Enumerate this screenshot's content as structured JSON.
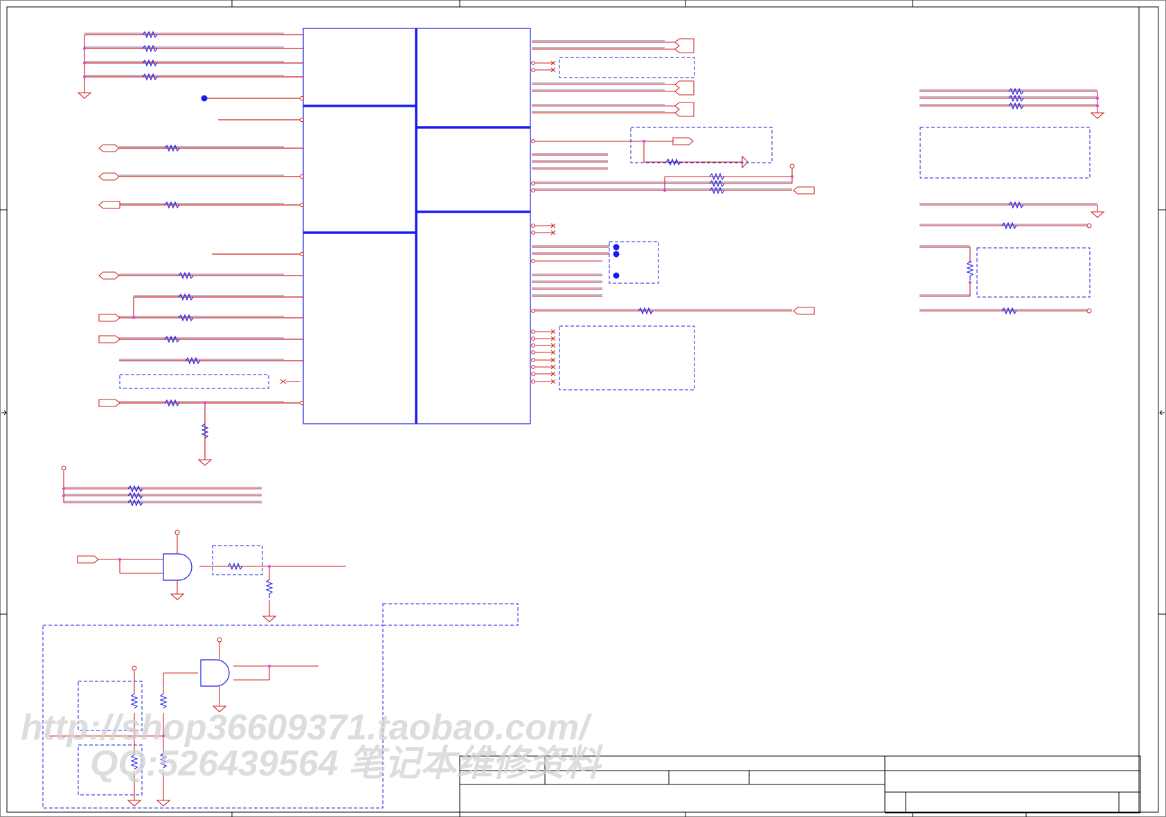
{
  "diagram": {
    "type": "schematic",
    "colors": {
      "wire": "#cc1f1f",
      "net_overline": "#6a2f6a",
      "component": "#1a1aee",
      "junction": "#e040e0",
      "frame": "#000000",
      "watermark": "#d2d2d2"
    }
  },
  "watermark": {
    "line1": "http://shop36609371.taobao.com/",
    "line2": "QQ:526439564 笔记本维修资料"
  }
}
